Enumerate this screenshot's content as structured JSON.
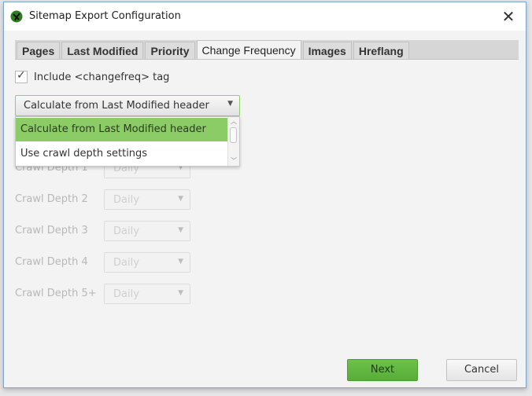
{
  "window": {
    "title": "Sitemap Export Configuration",
    "app_icon": "frog-logo-icon",
    "close_icon": "close-icon",
    "close_glyph": "✕"
  },
  "tabs": [
    {
      "label": "Pages",
      "active": false
    },
    {
      "label": "Last Modified",
      "active": false
    },
    {
      "label": "Priority",
      "active": false
    },
    {
      "label": "Change Frequency",
      "active": true
    },
    {
      "label": "Images",
      "active": false
    },
    {
      "label": "Hreflang",
      "active": false
    }
  ],
  "include_changefreq": {
    "label": "Include <changefreq> tag",
    "checked": true,
    "check_glyph": "✓"
  },
  "mode_select": {
    "selected": "Calculate from Last Modified header",
    "expanded": true,
    "arrow_glyph": "▼",
    "options": [
      {
        "label": "Calculate from Last Modified header",
        "selected": true
      },
      {
        "label": "Use crawl depth settings",
        "selected": false
      }
    ],
    "scroll_up_glyph": "︿",
    "scroll_down_glyph": "﹀"
  },
  "crawl_depths": [
    {
      "label": "Crawl Depth 1",
      "value": "Daily",
      "enabled": false
    },
    {
      "label": "Crawl Depth 2",
      "value": "Daily",
      "enabled": false
    },
    {
      "label": "Crawl Depth 3",
      "value": "Daily",
      "enabled": false
    },
    {
      "label": "Crawl Depth 4",
      "value": "Daily",
      "enabled": false
    },
    {
      "label": "Crawl Depth 5+",
      "value": "Daily",
      "enabled": false
    }
  ],
  "depth_arrow_glyph": "▼",
  "buttons": {
    "next": "Next",
    "cancel": "Cancel"
  },
  "colors": {
    "accent_green": "#8ccc66",
    "next_button": "#6cc24a",
    "window_border": "#7ea7cf"
  }
}
